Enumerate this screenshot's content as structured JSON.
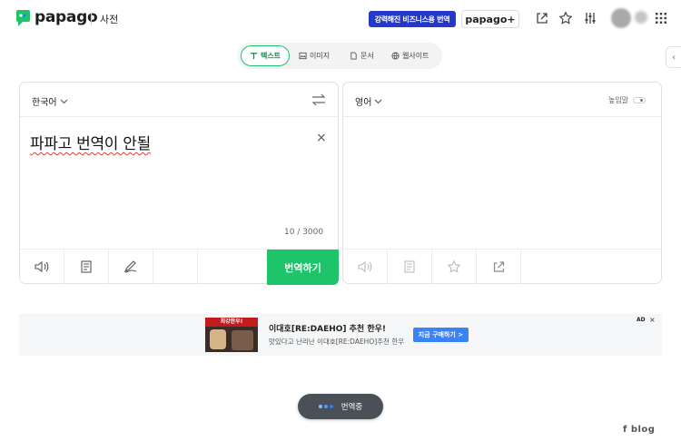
{
  "header": {
    "logo_text": "papago",
    "dict_label": "사전",
    "biz_button_label": "강력해진 비즈니스용 번역",
    "plus_button_label": "papago+"
  },
  "mode_tabs": [
    {
      "label": "텍스트",
      "active": true,
      "icon": "text-icon"
    },
    {
      "label": "이미지",
      "active": false,
      "icon": "image-icon"
    },
    {
      "label": "문서",
      "active": false,
      "icon": "document-icon"
    },
    {
      "label": "웹사이트",
      "active": false,
      "icon": "globe-icon"
    }
  ],
  "source": {
    "language": "한국어",
    "text": "파파고 번역이 안될",
    "char_count": "10 / 3000",
    "translate_label": "번역하기"
  },
  "target": {
    "language": "영어",
    "honorific_label": "높임말"
  },
  "ad": {
    "thumb_caption": "최강한우!",
    "title": "이대호[RE:DAEHO] 추천 한우!",
    "description": "맛있다고 난리난 이대호[RE:DAEHO]추천 한우",
    "cta_label": "지금 구매하기 >",
    "badge": "AD",
    "close_label": "×"
  },
  "status": {
    "label": "번역중"
  },
  "watermark": "f  blog",
  "colors": {
    "accent_green": "#1ec46a",
    "brand_blue": "#2439c8",
    "ad_cta_blue": "#3b82f6",
    "status_pill": "#4a5058"
  }
}
